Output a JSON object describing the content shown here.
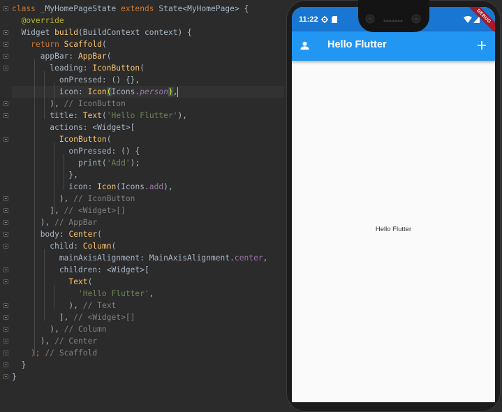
{
  "editor": {
    "lines": [
      {
        "tokens": [
          [
            "kw",
            "class "
          ],
          [
            "pl",
            "_MyHomePageState "
          ],
          [
            "kw",
            "extends "
          ],
          [
            "pl",
            "State<MyHomePage> {"
          ]
        ]
      },
      {
        "tokens": [
          [
            "an",
            "  @override"
          ]
        ]
      },
      {
        "tokens": [
          [
            "pl",
            "  Widget "
          ],
          [
            "cls",
            "build"
          ],
          [
            "pl",
            "(BuildContext context) {"
          ]
        ]
      },
      {
        "tokens": [
          [
            "kw",
            "    return "
          ],
          [
            "cls",
            "Scaffold"
          ],
          [
            "pl",
            "("
          ]
        ]
      },
      {
        "tokens": [
          [
            "pl",
            "      appBar: "
          ],
          [
            "cls",
            "AppBar"
          ],
          [
            "pl",
            "("
          ]
        ]
      },
      {
        "tokens": [
          [
            "pl",
            "        leading: "
          ],
          [
            "cls",
            "IconButton"
          ],
          [
            "pl",
            "("
          ]
        ]
      },
      {
        "tokens": [
          [
            "pl",
            "          onPressed: () {},"
          ]
        ]
      },
      {
        "tokens": [
          [
            "pl",
            "          icon: "
          ],
          [
            "cls",
            "Icon"
          ],
          [
            "brk",
            "("
          ],
          [
            "pl",
            "Icons."
          ],
          [
            "fldi",
            "person"
          ],
          [
            "brk",
            ")"
          ],
          [
            "pl",
            ","
          ]
        ]
      },
      {
        "tokens": [
          [
            "pl",
            "        ), "
          ],
          [
            "cm",
            "// IconButton"
          ]
        ]
      },
      {
        "tokens": [
          [
            "pl",
            "        title: "
          ],
          [
            "cls",
            "Text"
          ],
          [
            "pl",
            "("
          ],
          [
            "str",
            "'Hello Flutter'"
          ],
          [
            "pl",
            "),"
          ]
        ]
      },
      {
        "tokens": [
          [
            "pl",
            "        actions: <Widget>["
          ]
        ]
      },
      {
        "tokens": [
          [
            "pl",
            "          "
          ],
          [
            "cls",
            "IconButton"
          ],
          [
            "pl",
            "("
          ]
        ]
      },
      {
        "tokens": [
          [
            "pl",
            "            onPressed: () {"
          ]
        ]
      },
      {
        "tokens": [
          [
            "pl",
            "              print("
          ],
          [
            "str",
            "'Add'"
          ],
          [
            "pl",
            ");"
          ]
        ]
      },
      {
        "tokens": [
          [
            "pl",
            "            },"
          ]
        ]
      },
      {
        "tokens": [
          [
            "pl",
            "            icon: "
          ],
          [
            "cls",
            "Icon"
          ],
          [
            "pl",
            "(Icons."
          ],
          [
            "fld",
            "add"
          ],
          [
            "pl",
            "),"
          ]
        ]
      },
      {
        "tokens": [
          [
            "pl",
            "          ), "
          ],
          [
            "cm",
            "// IconButton"
          ]
        ]
      },
      {
        "tokens": [
          [
            "pl",
            "        ], "
          ],
          [
            "cm",
            "// <Widget>[]"
          ]
        ]
      },
      {
        "tokens": [
          [
            "pl",
            "      ), "
          ],
          [
            "cm",
            "// AppBar"
          ]
        ]
      },
      {
        "tokens": [
          [
            "pl",
            "      body: "
          ],
          [
            "cls",
            "Center"
          ],
          [
            "pl",
            "("
          ]
        ]
      },
      {
        "tokens": [
          [
            "pl",
            "        child: "
          ],
          [
            "cls",
            "Column"
          ],
          [
            "pl",
            "("
          ]
        ]
      },
      {
        "tokens": [
          [
            "pl",
            "          mainAxisAlignment: MainAxisAlignment."
          ],
          [
            "fld",
            "center"
          ],
          [
            "pl",
            ","
          ]
        ]
      },
      {
        "tokens": [
          [
            "pl",
            "          children: <Widget>["
          ]
        ]
      },
      {
        "tokens": [
          [
            "pl",
            "            "
          ],
          [
            "cls",
            "Text"
          ],
          [
            "pl",
            "("
          ]
        ]
      },
      {
        "tokens": [
          [
            "str",
            "              'Hello Flutter'"
          ],
          [
            "pl",
            ","
          ]
        ]
      },
      {
        "tokens": [
          [
            "pl",
            "            ), "
          ],
          [
            "cm",
            "// Text"
          ]
        ]
      },
      {
        "tokens": [
          [
            "pl",
            "          ], "
          ],
          [
            "cm",
            "// <Widget>[]"
          ]
        ]
      },
      {
        "tokens": [
          [
            "pl",
            "        ), "
          ],
          [
            "cm",
            "// Column"
          ]
        ]
      },
      {
        "tokens": [
          [
            "pl",
            "      ), "
          ],
          [
            "cm",
            "// Center"
          ]
        ]
      },
      {
        "tokens": [
          [
            "kw",
            "    ); "
          ],
          [
            "cm",
            "// Scaffold"
          ]
        ]
      },
      {
        "tokens": [
          [
            "pl",
            "  }"
          ]
        ]
      },
      {
        "tokens": [
          [
            "pl",
            "}"
          ]
        ]
      }
    ]
  },
  "device": {
    "status_time": "11:22",
    "appbar_title": "Hello Flutter",
    "body_text": "Hello Flutter",
    "debug_label": "DEBUG",
    "colors": {
      "primary": "#2196f3",
      "primary_dark": "#1976d2"
    },
    "icons": {
      "leading": "person-icon",
      "action": "add-icon"
    }
  }
}
